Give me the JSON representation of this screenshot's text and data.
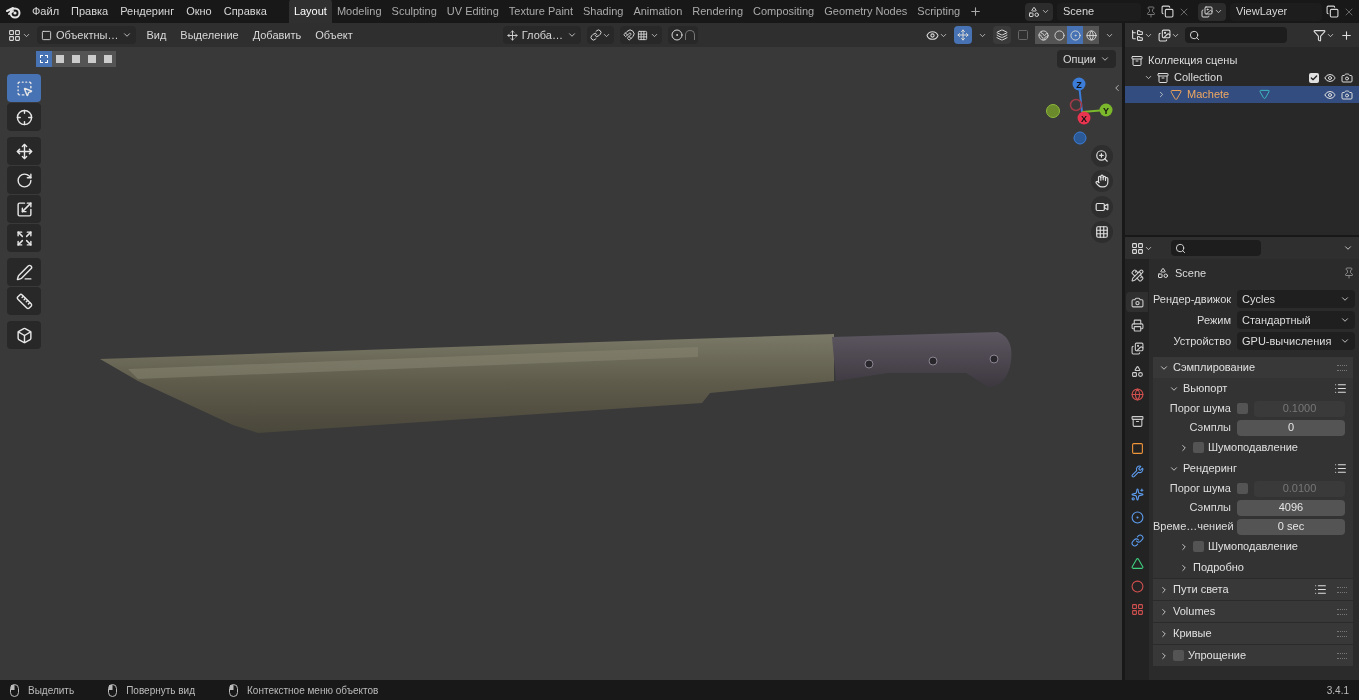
{
  "menu_bar": {
    "items": [
      "Файл",
      "Правка",
      "Рендеринг",
      "Окно",
      "Справка"
    ]
  },
  "workspaces": [
    {
      "label": "Layout",
      "selected": true
    },
    {
      "label": "Modeling",
      "selected": false
    },
    {
      "label": "Sculpting",
      "selected": false
    },
    {
      "label": "UV Editing",
      "selected": false
    },
    {
      "label": "Texture Paint",
      "selected": false
    },
    {
      "label": "Shading",
      "selected": false
    },
    {
      "label": "Animation",
      "selected": false
    },
    {
      "label": "Rendering",
      "selected": false
    },
    {
      "label": "Compositing",
      "selected": false
    },
    {
      "label": "Geometry Nodes",
      "selected": false
    },
    {
      "label": "Scripting",
      "selected": false
    }
  ],
  "scene": {
    "value": "Scene"
  },
  "view_layer": {
    "value": "ViewLayer"
  },
  "viewport": {
    "mode": "Объектны…",
    "menus": [
      "Вид",
      "Выделение",
      "Добавить",
      "Объект"
    ],
    "orientation": "Глоба…",
    "gizmos_on": true,
    "shading": [
      {
        "kind": "wireframe",
        "selected": false
      },
      {
        "kind": "solid",
        "selected": false
      },
      {
        "kind": "material",
        "selected": true
      },
      {
        "kind": "rendered",
        "selected": false
      }
    ],
    "options": "Опции",
    "select_modes": [
      {
        "selected": true
      },
      {
        "selected": false
      },
      {
        "selected": false
      },
      {
        "selected": false
      },
      {
        "selected": false
      }
    ],
    "tool_groups": [
      [
        {
          "kind": "select",
          "selected": true
        },
        {
          "kind": "cursor",
          "selected": false
        }
      ],
      [
        {
          "kind": "move",
          "selected": false
        },
        {
          "kind": "rotate",
          "selected": false
        },
        {
          "kind": "scale",
          "selected": false
        },
        {
          "kind": "transform",
          "selected": false
        }
      ],
      [
        {
          "kind": "annotate",
          "selected": false
        },
        {
          "kind": "measure",
          "selected": false
        }
      ],
      [
        {
          "kind": "add_cube",
          "selected": false
        }
      ]
    ],
    "axis_labels": [
      "Z",
      "Y",
      "X"
    ]
  },
  "outliner": {
    "tree": [
      {
        "label": "Коллекция сцены",
        "selected": false,
        "children": [
          {
            "label": "Collection",
            "expanded": true,
            "checked": true,
            "selected": false,
            "children": [
              {
                "label": "Machete",
                "expanded": false,
                "selected": true
              }
            ]
          }
        ]
      }
    ]
  },
  "properties": {
    "context": "Scene",
    "tab_groups": [
      [
        {
          "kind": "tool",
          "selected": false
        }
      ],
      [
        {
          "kind": "render",
          "selected": true
        },
        {
          "kind": "output",
          "selected": false
        },
        {
          "kind": "view_layer",
          "selected": false
        },
        {
          "kind": "scene",
          "selected": false
        },
        {
          "kind": "world",
          "selected": false
        }
      ],
      [
        {
          "kind": "collection",
          "selected": false
        }
      ],
      [
        {
          "kind": "object",
          "selected": false
        },
        {
          "kind": "modifiers",
          "selected": false
        },
        {
          "kind": "particles",
          "selected": false
        },
        {
          "kind": "physics",
          "selected": false
        },
        {
          "kind": "constraints",
          "selected": false
        },
        {
          "kind": "data",
          "selected": false
        },
        {
          "kind": "material",
          "selected": false
        },
        {
          "kind": "texture",
          "selected": false
        }
      ]
    ],
    "fields": [
      {
        "label": "Рендер-движок",
        "value": "Cycles"
      },
      {
        "label": "Режим",
        "value": "Стандартный"
      },
      {
        "label": "Устройство",
        "value": "GPU-вычисления"
      }
    ],
    "panels": [
      {
        "kind": "panel",
        "title": "Сэмплирование",
        "expanded": true,
        "children": [
          {
            "kind": "panel",
            "title": "Вьюпорт",
            "expanded": true,
            "presets": true,
            "children": [
              {
                "kind": "toggle_number",
                "label": "Порог шума",
                "checked": false,
                "value": "0.1000"
              },
              {
                "kind": "number",
                "label": "Сэмплы",
                "value": "0"
              },
              {
                "kind": "panel",
                "title": "Шумоподавление",
                "expanded": false,
                "checked": false
              }
            ]
          },
          {
            "kind": "panel",
            "title": "Рендеринг",
            "expanded": true,
            "presets": true,
            "children": [
              {
                "kind": "toggle_number",
                "label": "Порог шума",
                "checked": false,
                "value": "0.0100"
              },
              {
                "kind": "number",
                "label": "Сэмплы",
                "value": "4096"
              },
              {
                "kind": "number",
                "label": "Време…ченией",
                "value": "0 sec"
              },
              {
                "kind": "panel",
                "title": "Шумоподавление",
                "expanded": false,
                "checked": false
              },
              {
                "kind": "panel",
                "title": "Подробно",
                "expanded": false
              }
            ]
          }
        ]
      },
      {
        "kind": "panel",
        "title": "Пути света",
        "expanded": false,
        "presets": true
      },
      {
        "kind": "panel",
        "title": "Volumes",
        "expanded": false
      },
      {
        "kind": "panel",
        "title": "Кривые",
        "expanded": false
      },
      {
        "kind": "panel",
        "title": "Упрощение",
        "expanded": false,
        "checked": false
      }
    ]
  },
  "status_bar": {
    "hints": [
      "Выделить",
      "Повернуть вид",
      "Контекстное меню объектов"
    ],
    "version": "3.4.1"
  }
}
